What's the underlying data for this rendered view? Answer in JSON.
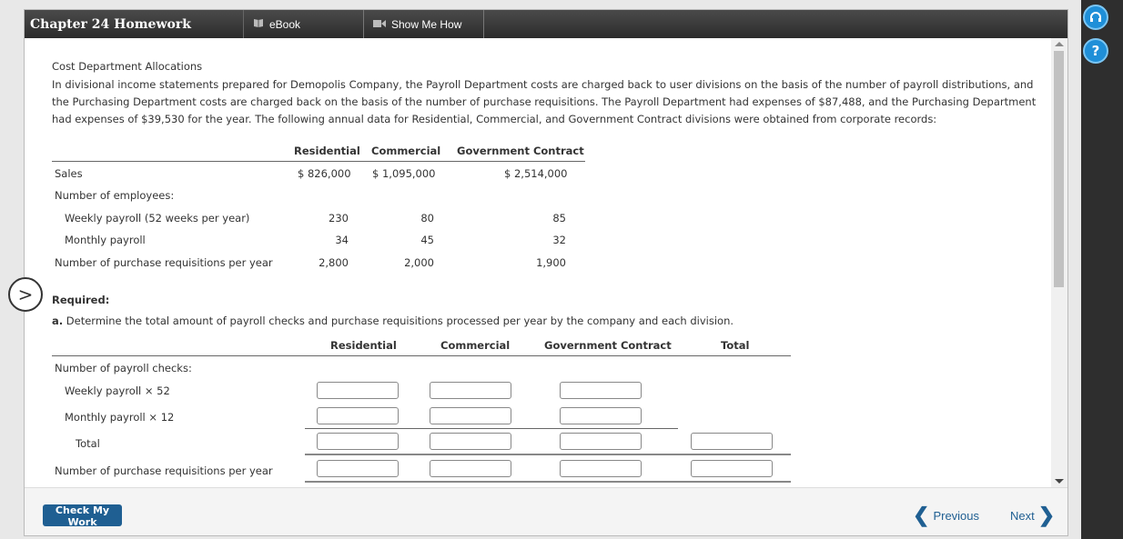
{
  "header": {
    "title": "Chapter 24 Homework",
    "ebook_label": "eBook",
    "show_me_how_label": "Show Me How"
  },
  "problem": {
    "heading": "Cost Department Allocations",
    "paragraph": "In divisional income statements prepared for Demopolis Company, the Payroll Department costs are charged back to user divisions on the basis of the number of payroll distributions, and the Purchasing Department costs are charged back on the basis of the number of purchase requisitions. The Payroll Department had expenses of $87,488, and the Purchasing Department had expenses of $39,530 for the year. The following annual data for Residential, Commercial, and Government Contract divisions were obtained from corporate records:"
  },
  "data_table": {
    "headers": [
      "Residential",
      "Commercial",
      "Government Contract"
    ],
    "rows": [
      {
        "label": "Sales",
        "values": [
          "$ 826,000",
          "$ 1,095,000",
          "$ 2,514,000"
        ]
      },
      {
        "label": "Number of employees:",
        "values": [
          "",
          "",
          ""
        ]
      },
      {
        "label": "Weekly payroll (52 weeks per year)",
        "values": [
          "230",
          "80",
          "85"
        ]
      },
      {
        "label": "Monthly payroll",
        "values": [
          "34",
          "45",
          "32"
        ]
      },
      {
        "label": "Number of purchase requisitions per year",
        "values": [
          "2,800",
          "2,000",
          "1,900"
        ]
      }
    ]
  },
  "required": {
    "label": "Required:",
    "part_a_letter": "a.",
    "part_a_text": "Determine the total amount of payroll checks and purchase requisitions processed per year by the company and each division.",
    "headers": [
      "Residential",
      "Commercial",
      "Government Contract",
      "Total"
    ],
    "rows": [
      {
        "label": "Number of payroll checks:"
      },
      {
        "label": "Weekly payroll × 52"
      },
      {
        "label": "Monthly payroll × 12"
      },
      {
        "label": "Total"
      },
      {
        "label": "Number of purchase requisitions per year"
      }
    ]
  },
  "footer": {
    "check_my_work": "Check My Work",
    "previous": "Previous",
    "next": "Next"
  },
  "icons": {
    "headset": "headset-icon",
    "help": "help-icon"
  },
  "colors": {
    "accent": "#1f5f92",
    "strip_button": "#1f8fd8"
  }
}
